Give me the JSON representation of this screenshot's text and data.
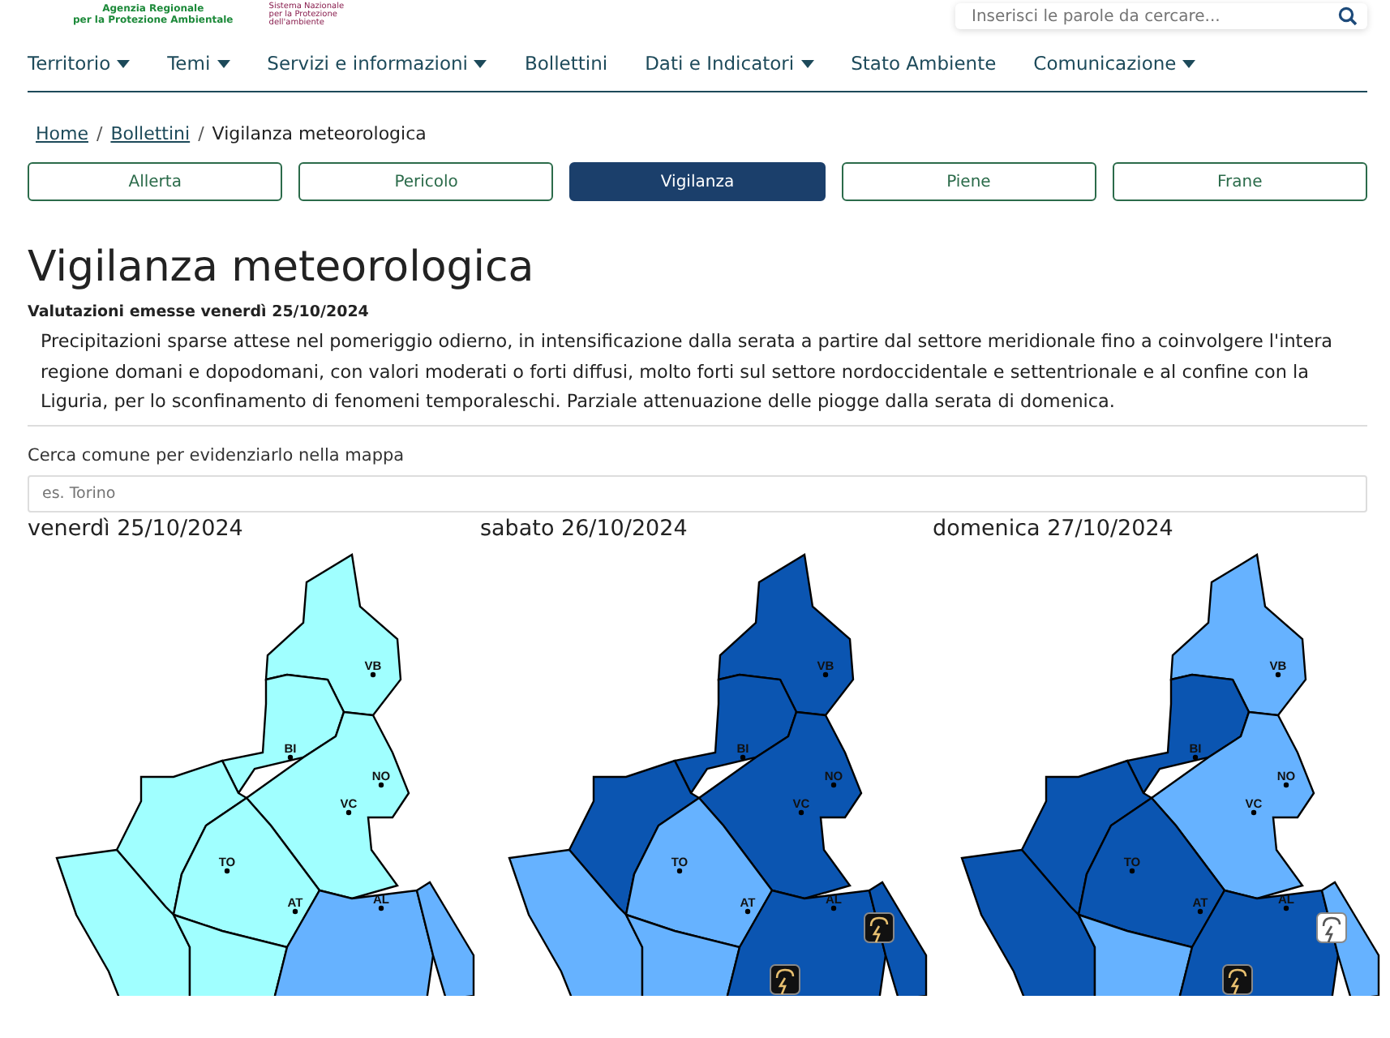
{
  "header": {
    "logo_lines": [
      "Agenzia Regionale",
      "per la Protezione Ambientale"
    ],
    "partner_lines": [
      "Sistema Nazionale",
      "per la Protezione",
      "dell'ambiente"
    ],
    "search": {
      "placeholder": "Inserisci le parole da cercare..."
    }
  },
  "nav": [
    {
      "label": "Territorio",
      "dropdown": true
    },
    {
      "label": "Temi",
      "dropdown": true
    },
    {
      "label": "Servizi e informazioni",
      "dropdown": true
    },
    {
      "label": "Bollettini",
      "dropdown": false
    },
    {
      "label": "Dati e Indicatori",
      "dropdown": true
    },
    {
      "label": "Stato Ambiente",
      "dropdown": false
    },
    {
      "label": "Comunicazione",
      "dropdown": true
    }
  ],
  "breadcrumb": [
    {
      "kind": "link",
      "label": "Home"
    },
    {
      "kind": "separator",
      "label": "/"
    },
    {
      "kind": "link",
      "label": "Bollettini"
    },
    {
      "kind": "separator",
      "label": "/"
    },
    {
      "kind": "current",
      "label": "Vigilanza meteorologica"
    }
  ],
  "tabs": [
    {
      "label": "Allerta",
      "selected": false
    },
    {
      "label": "Pericolo",
      "selected": false
    },
    {
      "label": "Vigilanza",
      "selected": true
    },
    {
      "label": "Piene",
      "selected": false
    },
    {
      "label": "Frane",
      "selected": false
    }
  ],
  "title": "Vigilanza meteorologica",
  "issued": "Valutazioni emesse venerdì 25/10/2024",
  "summary": "Precipitazioni sparse attese nel pomeriggio odierno, in intensificazione dalla serata a partire dal settore meridionale fino a coinvolgere l'intera regione domani e dopodomani, con valori moderati o forti diffusi, molto forti sul settore nordoccidentale e settentrionale e al confine con la Liguria, per lo sconfinamento di fenomeni temporaleschi. Parziale attenuazione delle piogge dalla serata di domenica.",
  "municipality_search": {
    "label": "Cerca comune per evidenziarlo nella mappa",
    "placeholder": "es. Torino"
  },
  "maps": [
    {
      "date": "venerdì 25/10/2024",
      "labels": [
        "VB",
        "BI",
        "NO",
        "VC",
        "TO",
        "AT",
        "AL"
      ],
      "zones": [
        {
          "color": "#a0ffff",
          "kind": "plain"
        },
        {
          "color": "#a0ffff",
          "kind": "plain"
        },
        {
          "color": "#a0ffff",
          "kind": "plain"
        },
        {
          "color": "#a0ffff",
          "kind": "plain"
        },
        {
          "color": "#a0ffff",
          "kind": "plain"
        },
        {
          "color": "#a0ffff",
          "kind": "plain"
        },
        {
          "color": "#a0ffff",
          "kind": "plain"
        },
        {
          "color": "#66b2ff",
          "kind": "plain"
        },
        {
          "color": "#66b2ff",
          "kind": "plain"
        }
      ]
    },
    {
      "date": "sabato 26/10/2024",
      "labels": [
        "VB",
        "BI",
        "NO",
        "VC",
        "TO",
        "AT",
        "AL"
      ],
      "zones": [
        {
          "color": "#0b55b1",
          "kind": "plain"
        },
        {
          "color": "#0b55b1",
          "kind": "plain"
        },
        {
          "color": "#0b55b1",
          "kind": "plain"
        },
        {
          "color": "#0b55b1",
          "kind": "plain"
        },
        {
          "color": "#66b2ff",
          "kind": "plain"
        },
        {
          "color": "#66b2ff",
          "kind": "plain"
        },
        {
          "color": "#66b2ff",
          "kind": "plain"
        },
        {
          "color": "#0b55b1",
          "kind": "severe"
        },
        {
          "color": "#0b55b1",
          "kind": "severe"
        }
      ]
    },
    {
      "date": "domenica 27/10/2024",
      "labels": [
        "VB",
        "BI",
        "NO",
        "VC",
        "TO",
        "AT",
        "AL"
      ],
      "zones": [
        {
          "color": "#66b2ff",
          "kind": "plain"
        },
        {
          "color": "#0b55b1",
          "kind": "plain"
        },
        {
          "color": "#66b2ff",
          "kind": "plain"
        },
        {
          "color": "#0b55b1",
          "kind": "plain"
        },
        {
          "color": "#0b55b1",
          "kind": "plain"
        },
        {
          "color": "#0b55b1",
          "kind": "plain"
        },
        {
          "color": "#66b2ff",
          "kind": "plain"
        },
        {
          "color": "#0b55b1",
          "kind": "severe"
        },
        {
          "color": "#66b2ff",
          "kind": "storm"
        }
      ]
    }
  ]
}
